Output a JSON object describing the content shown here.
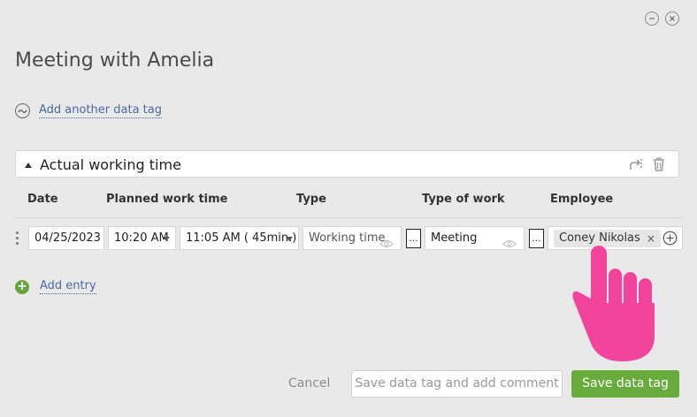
{
  "window": {
    "minimize_icon": "minus-circle-icon",
    "close_icon": "close-circle-icon"
  },
  "title": "Meeting with Amelia",
  "add_tag": {
    "label": "Add another data tag",
    "icon": "tilde-circle-icon"
  },
  "section": {
    "title": "Actual working time",
    "icons": [
      "share-icon",
      "trash-icon"
    ]
  },
  "columns": [
    "Date",
    "Planned work time",
    "Type",
    "Type of work",
    "Employee"
  ],
  "entry": {
    "date": "04/25/2023",
    "start_time": "10:20 AM",
    "end_time": "11:05 AM ( 45min.)",
    "type": "Working time",
    "type_more": "...",
    "type_of_work": "Meeting",
    "type_of_work_more": "...",
    "employee": "Coney Nikolas",
    "employee_remove": "×"
  },
  "add_entry": {
    "label": "Add entry",
    "icon": "plus-circle-icon"
  },
  "buttons": {
    "cancel": "Cancel",
    "save_comment": "Save data tag and add comment",
    "save": "Save data tag"
  },
  "colors": {
    "accent_green": "#6aab3e",
    "link_blue": "#4a6aa3",
    "hand_pink": "#f2449a"
  }
}
